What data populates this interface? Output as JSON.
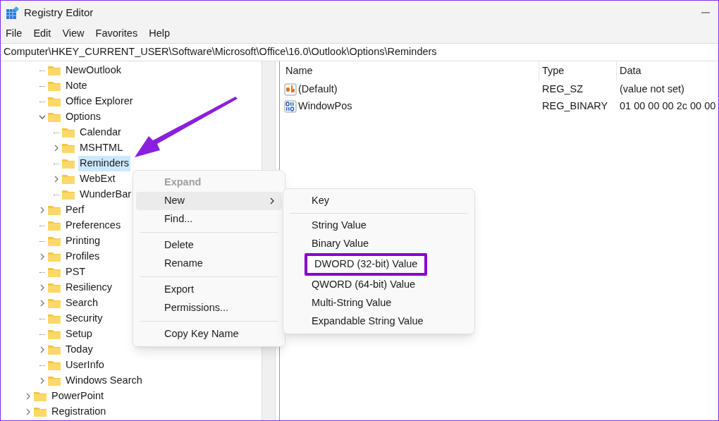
{
  "window": {
    "title": "Registry Editor"
  },
  "menu_bar": [
    "File",
    "Edit",
    "View",
    "Favorites",
    "Help"
  ],
  "address": "Computer\\HKEY_CURRENT_USER\\Software\\Microsoft\\Office\\16.0\\Outlook\\Options\\Reminders",
  "tree": [
    {
      "children": [
        {
          "label": "NewOutlook",
          "expandable": false,
          "expanded": false,
          "selected": false
        },
        {
          "label": "Note",
          "expandable": false,
          "expanded": false,
          "selected": false
        },
        {
          "label": "Office Explorer",
          "expandable": false,
          "expanded": false,
          "selected": false
        },
        {
          "label": "Options",
          "expandable": true,
          "expanded": true,
          "selected": false,
          "children": [
            {
              "label": "Calendar",
              "expandable": false,
              "expanded": false,
              "selected": false
            },
            {
              "label": "MSHTML",
              "expandable": true,
              "expanded": false,
              "selected": false
            },
            {
              "label": "Reminders",
              "expandable": false,
              "expanded": false,
              "selected": true
            },
            {
              "label": "WebExt",
              "expandable": true,
              "expanded": false,
              "selected": false
            },
            {
              "label": "WunderBar",
              "expandable": false,
              "expanded": false,
              "selected": false
            }
          ]
        },
        {
          "label": "Perf",
          "expandable": true,
          "expanded": false,
          "selected": false
        },
        {
          "label": "Preferences",
          "expandable": false,
          "expanded": false,
          "selected": false
        },
        {
          "label": "Printing",
          "expandable": false,
          "expanded": false,
          "selected": false
        },
        {
          "label": "Profiles",
          "expandable": true,
          "expanded": false,
          "selected": false
        },
        {
          "label": "PST",
          "expandable": false,
          "expanded": false,
          "selected": false
        },
        {
          "label": "Resiliency",
          "expandable": true,
          "expanded": false,
          "selected": false
        },
        {
          "label": "Search",
          "expandable": true,
          "expanded": false,
          "selected": false
        },
        {
          "label": "Security",
          "expandable": false,
          "expanded": false,
          "selected": false
        },
        {
          "label": "Setup",
          "expandable": false,
          "expanded": false,
          "selected": false
        },
        {
          "label": "Today",
          "expandable": true,
          "expanded": false,
          "selected": false
        },
        {
          "label": "UserInfo",
          "expandable": false,
          "expanded": false,
          "selected": false
        },
        {
          "label": "Windows Search",
          "expandable": true,
          "expanded": false,
          "selected": false
        }
      ]
    },
    {
      "label": "PowerPoint",
      "expandable": true,
      "expanded": false,
      "selected": false
    },
    {
      "label": "Registration",
      "expandable": true,
      "expanded": false,
      "selected": false
    }
  ],
  "values_table": {
    "columns": [
      "Name",
      "Type",
      "Data"
    ],
    "rows": [
      {
        "kind": "string",
        "name": "(Default)",
        "type": "REG_SZ",
        "data": "(value not set)"
      },
      {
        "kind": "binary",
        "name": "WindowPos",
        "type": "REG_BINARY",
        "data": "01 00 00 00 2c 00 00"
      }
    ]
  },
  "context_menu": [
    {
      "kind": "item",
      "label": "Expand",
      "disabled": true,
      "default": true,
      "hovered": false,
      "has_submenu": false
    },
    {
      "kind": "item",
      "label": "New",
      "disabled": false,
      "default": false,
      "hovered": true,
      "has_submenu": true
    },
    {
      "kind": "item",
      "label": "Find...",
      "disabled": false,
      "default": false,
      "hovered": false,
      "has_submenu": false
    },
    {
      "kind": "separator"
    },
    {
      "kind": "item",
      "label": "Delete",
      "disabled": false,
      "default": false,
      "hovered": false,
      "has_submenu": false
    },
    {
      "kind": "item",
      "label": "Rename",
      "disabled": false,
      "default": false,
      "hovered": false,
      "has_submenu": false
    },
    {
      "kind": "separator"
    },
    {
      "kind": "item",
      "label": "Export",
      "disabled": false,
      "default": false,
      "hovered": false,
      "has_submenu": false
    },
    {
      "kind": "item",
      "label": "Permissions...",
      "disabled": false,
      "default": false,
      "hovered": false,
      "has_submenu": false
    },
    {
      "kind": "separator"
    },
    {
      "kind": "item",
      "label": "Copy Key Name",
      "disabled": false,
      "default": false,
      "hovered": false,
      "has_submenu": false
    }
  ],
  "submenu": [
    {
      "kind": "item",
      "label": "Key",
      "highlighted": false
    },
    {
      "kind": "separator"
    },
    {
      "kind": "item",
      "label": "String Value",
      "highlighted": false
    },
    {
      "kind": "item",
      "label": "Binary Value",
      "highlighted": false
    },
    {
      "kind": "item",
      "label": "DWORD (32-bit) Value",
      "highlighted": true
    },
    {
      "kind": "item",
      "label": "QWORD (64-bit) Value",
      "highlighted": false
    },
    {
      "kind": "item",
      "label": "Multi-String Value",
      "highlighted": false
    },
    {
      "kind": "item",
      "label": "Expandable String Value",
      "highlighted": false
    }
  ]
}
